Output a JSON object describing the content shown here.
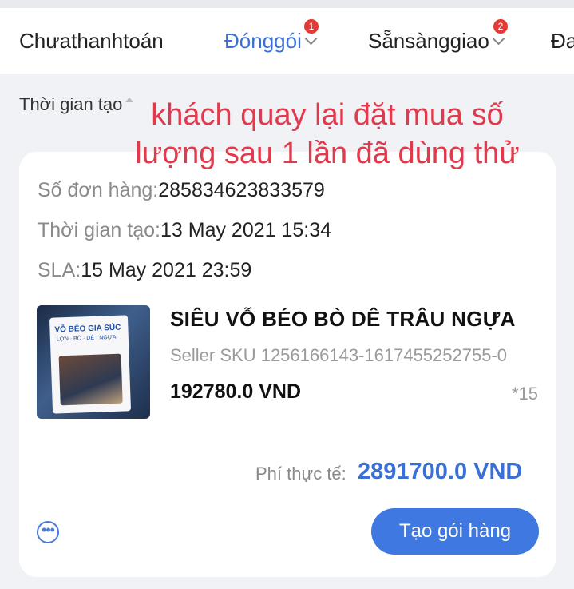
{
  "tabs": [
    {
      "label": "Chưathanhtoán",
      "badge": ""
    },
    {
      "label": "Đónggói",
      "badge": "1"
    },
    {
      "label": "Sẵnsànggiao",
      "badge": "2"
    },
    {
      "label": "Đa",
      "badge": ""
    }
  ],
  "sort": {
    "label": "Thời gian tạo"
  },
  "overlay": {
    "line1": "khách quay lại đặt mua số",
    "line2": "lượng sau 1 lần đã dùng thử"
  },
  "order": {
    "number_label": "Số đơn hàng:",
    "number": "285834623833579",
    "created_label": "Thời gian tạo:",
    "created": "13 May 2021 15:34",
    "sla_label": "SLA:",
    "sla": "15 May 2021 23:59",
    "product": {
      "name": "SIÊU VỖ BÉO BÒ DÊ TRÂU NGỰA",
      "sku": "Seller SKU 1256166143-1617455252755-0",
      "price": "192780.0 VND",
      "qty": "*15",
      "package_title": "VỖ BÉO GIA SÚC",
      "package_subtitle": "LỢN · BÒ · DÊ · NGỰA"
    },
    "total_label": "Phí thực tế:",
    "total": "2891700.0 VND",
    "action_button": "Tạo gói hàng",
    "more_icon": "more-options-icon"
  }
}
